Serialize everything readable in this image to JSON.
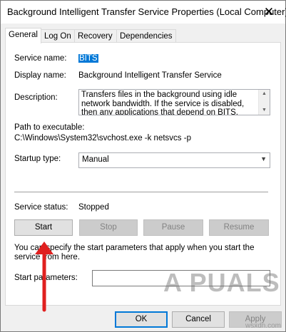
{
  "window": {
    "title": "Background Intelligent Transfer Service Properties (Local Computer)",
    "close_glyph": "✕"
  },
  "tabs": [
    {
      "label": "General",
      "active": true
    },
    {
      "label": "Log On",
      "active": false
    },
    {
      "label": "Recovery",
      "active": false
    },
    {
      "label": "Dependencies",
      "active": false
    }
  ],
  "general": {
    "service_name_label": "Service name:",
    "service_name_value": "BITS",
    "display_name_label": "Display name:",
    "display_name_value": "Background Intelligent Transfer Service",
    "description_label": "Description:",
    "description_value": "Transfers files in the background using idle network bandwidth. If the service is disabled, then any applications that depend on BITS, such as Windows",
    "path_label": "Path to executable:",
    "path_value": "C:\\Windows\\System32\\svchost.exe -k netsvcs -p",
    "startup_type_label": "Startup type:",
    "startup_type_value": "Manual",
    "service_status_label": "Service status:",
    "service_status_value": "Stopped",
    "buttons": {
      "start": "Start",
      "stop": "Stop",
      "pause": "Pause",
      "resume": "Resume"
    },
    "hint_text": "You can specify the start parameters that apply when you start the service from here.",
    "start_parameters_label": "Start parameters:",
    "start_parameters_value": ""
  },
  "footer": {
    "ok": "OK",
    "cancel": "Cancel",
    "apply": "Apply"
  },
  "watermark": {
    "logo": "A PUALS",
    "site": "wsxdn.com"
  },
  "colors": {
    "selection": "#0078d7",
    "arrow": "#e0201f"
  }
}
